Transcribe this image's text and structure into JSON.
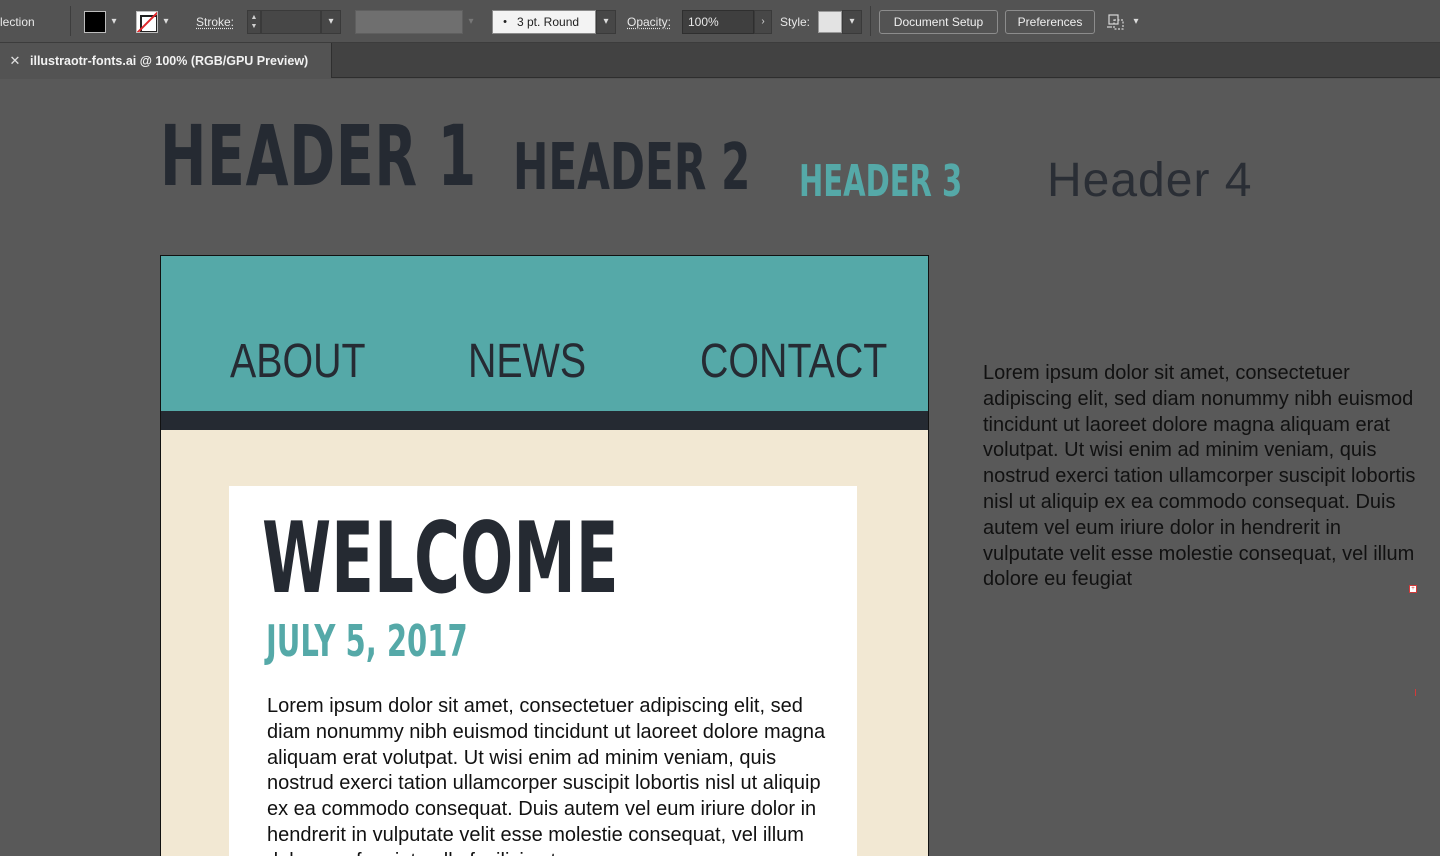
{
  "control_bar": {
    "mode_label": "lection",
    "stroke_label": "Stroke:",
    "brush_label": "3 pt. Round",
    "opacity_label": "Opacity:",
    "opacity_value": "100%",
    "style_label": "Style:",
    "document_setup": "Document Setup",
    "preferences": "Preferences",
    "icons": {
      "chevron": "▾",
      "brush_dot": "•",
      "spin_up": "▲",
      "spin_down": "▼",
      "arrow_right": "›"
    }
  },
  "tab": {
    "close": "✕",
    "title": "illustraotr-fonts.ai @ 100% (RGB/GPU Preview)"
  },
  "artboard": {
    "header1": "HEADER 1",
    "header2": "HEADER 2",
    "header3": "HEADER 3",
    "header4": "Header 4",
    "nav": [
      "ABOUT",
      "NEWS",
      "CONTACT"
    ],
    "welcome": "WELCOME",
    "date": "JULY 5, 2017",
    "body": "Lorem ipsum dolor sit amet, consectetuer adipiscing elit, sed diam nonummy nibh euismod tincidunt ut laoreet dolore magna aliquam erat volutpat. Ut wisi enim ad minim veniam, quis nostrud exerci tation ullamcorper suscipit lobortis nisl ut aliquip ex ea commodo consequat. Duis autem vel eum iriure dolor in hendrerit in vulputate velit esse molestie consequat, vel illum dolore eu feugiat nulla facilisis at",
    "side_text": "Lorem ipsum dolor sit amet, consectetuer adipiscing elit, sed diam nonummy nibh euismod tincidunt ut laoreet dolore magna aliquam erat volutpat. Ut wisi enim ad minim veniam, quis nostrud exerci tation ullamcorper suscipit lobortis nisl ut aliquip ex ea commodo consequat. Duis autem vel eum iriure dolor in hendrerit in vulputate velit esse molestie consequat, vel illum dolore eu feugiat",
    "overflow_marker": "+"
  },
  "colors": {
    "teal": "#55a9a8",
    "dark": "#252a32",
    "cream": "#f2e8d3",
    "canvas": "#595959"
  }
}
